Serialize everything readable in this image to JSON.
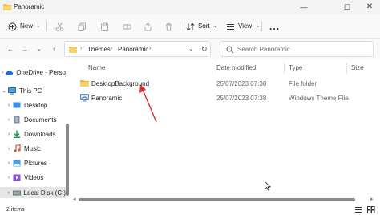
{
  "window": {
    "title": "Panoramic",
    "minimize_icon": "minimize-icon",
    "maximize_icon": "maximize-icon",
    "close_icon": "close-icon"
  },
  "toolbar": {
    "new_label": "New",
    "sort_label": "Sort",
    "view_label": "View",
    "more_label": "..."
  },
  "address": {
    "crumbs": [
      "Themes",
      "Panoramic"
    ]
  },
  "search": {
    "placeholder": "Search Panoramic"
  },
  "sidebar": {
    "items": [
      {
        "label": "OneDrive - Perso",
        "icon": "cloud-icon",
        "expander": "›"
      },
      {
        "label": "This PC",
        "icon": "pc-icon",
        "expander": "⌄"
      },
      {
        "label": "Desktop",
        "icon": "desktop-icon",
        "expander": "›"
      },
      {
        "label": "Documents",
        "icon": "documents-icon",
        "expander": "›"
      },
      {
        "label": "Downloads",
        "icon": "downloads-icon",
        "expander": "›"
      },
      {
        "label": "Music",
        "icon": "music-icon",
        "expander": "›"
      },
      {
        "label": "Pictures",
        "icon": "pictures-icon",
        "expander": "›"
      },
      {
        "label": "Videos",
        "icon": "videos-icon",
        "expander": "›"
      },
      {
        "label": "Local Disk (C:)",
        "icon": "drive-icon",
        "expander": "›"
      }
    ]
  },
  "columns": {
    "name": "Name",
    "date": "Date modified",
    "type": "Type",
    "size": "Size"
  },
  "files": [
    {
      "name": "DesktopBackground",
      "date": "25/07/2023 07:38",
      "type": "File folder",
      "size": "",
      "icon": "folder-icon"
    },
    {
      "name": "Panoramic",
      "date": "25/07/2023 07:38",
      "type": "Windows Theme File",
      "size": "",
      "icon": "theme-file-icon"
    }
  ],
  "status": {
    "item_count": "2 items"
  },
  "colors": {
    "folder": "#f2c14e",
    "accent": "#0067c0",
    "annotation_arrow": "#d32f2f"
  }
}
